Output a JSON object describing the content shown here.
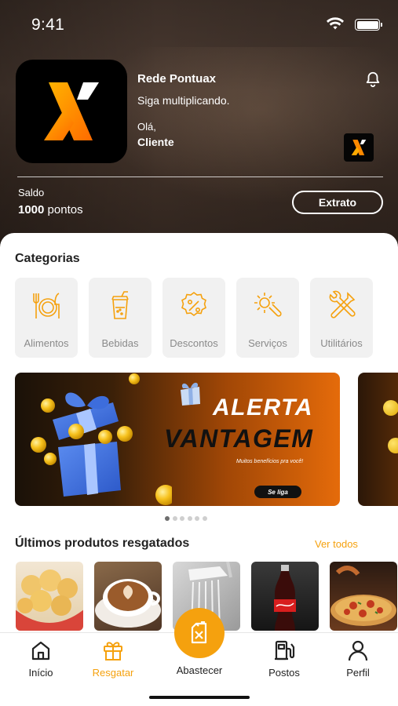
{
  "status_bar": {
    "time": "9:41"
  },
  "header": {
    "brand_name": "Rede Pontuax",
    "slogan": "Siga multiplicando.",
    "greeting": "Olá,",
    "user_name": "Cliente",
    "balance_label": "Saldo",
    "balance_value": "1000",
    "balance_unit": "pontos",
    "statement_button": "Extrato"
  },
  "categories": {
    "title": "Categorias",
    "items": [
      {
        "label": "Alimentos",
        "icon": "utensils-icon"
      },
      {
        "label": "Bebidas",
        "icon": "cup-straw-icon"
      },
      {
        "label": "Descontos",
        "icon": "percent-badge-icon"
      },
      {
        "label": "Serviços",
        "icon": "gear-wrench-icon"
      },
      {
        "label": "Utilitários",
        "icon": "tools-icon"
      }
    ]
  },
  "banner": {
    "line1": "ALERTA",
    "line2": "VANTAGEM",
    "subtitle": "Muitos benefícios pra você!",
    "cta": "Se liga"
  },
  "carousel": {
    "count": 6,
    "active_index": 0
  },
  "products": {
    "title": "Últimos produtos resgatados",
    "see_all": "Ver todos",
    "items": [
      "pao-de-queijo",
      "cappuccino",
      "ducha",
      "coca-cola",
      "pizza"
    ]
  },
  "nav": {
    "items": [
      {
        "label": "Início",
        "icon": "home-icon"
      },
      {
        "label": "Resgatar",
        "icon": "gift-icon",
        "active": true
      },
      {
        "label": "Abastecer",
        "icon": "fuel-can-icon"
      },
      {
        "label": "Postos",
        "icon": "fuel-pump-icon"
      },
      {
        "label": "Perfil",
        "icon": "user-icon"
      }
    ]
  },
  "colors": {
    "accent": "#f5a10e",
    "brand_orange": "#ff7a00",
    "brand_yellow": "#ffb300"
  }
}
